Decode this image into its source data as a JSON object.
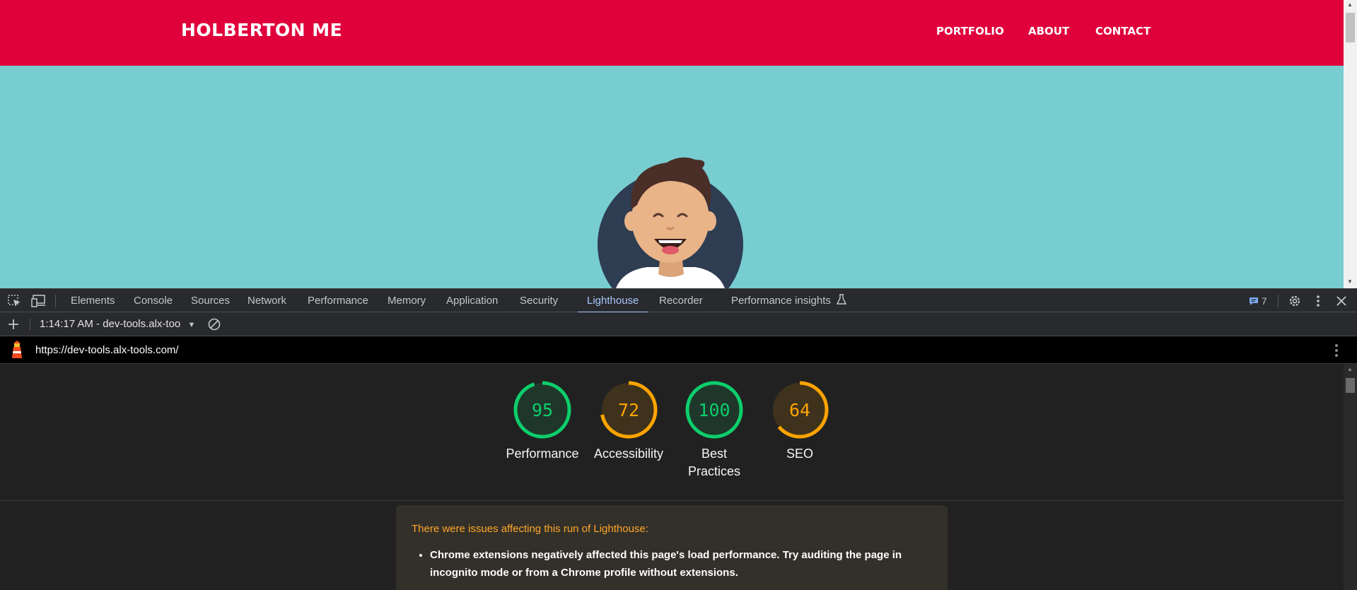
{
  "site": {
    "brand": "HOLBERTON ME",
    "nav": [
      "PORTFOLIO",
      "ABOUT",
      "CONTACT"
    ],
    "colors": {
      "header": "#e0003c",
      "hero": "#78cdd1"
    }
  },
  "devtools": {
    "tabs": [
      "Elements",
      "Console",
      "Sources",
      "Network",
      "Performance",
      "Memory",
      "Application",
      "Security",
      "Lighthouse",
      "Recorder",
      "Performance insights"
    ],
    "active_tab": "Lighthouse",
    "issues_count": "7",
    "report_select": "1:14:17 AM - dev-tools.alx-too",
    "url": "https://dev-tools.alx-tools.com/"
  },
  "lighthouse": {
    "scores": [
      {
        "value": "95",
        "label": "Performance",
        "color": "#0cce6b"
      },
      {
        "value": "72",
        "label": "Accessibility",
        "color": "#ffa400"
      },
      {
        "value": "100",
        "label": "Best Practices",
        "color": "#0cce6b"
      },
      {
        "value": "64",
        "label": "SEO",
        "color": "#ffa400"
      }
    ],
    "warning_title": "There were issues affecting this run of Lighthouse:",
    "warning_items": [
      "Chrome extensions negatively affected this page's load performance. Try auditing the page in incognito mode or from a Chrome profile without extensions."
    ]
  }
}
